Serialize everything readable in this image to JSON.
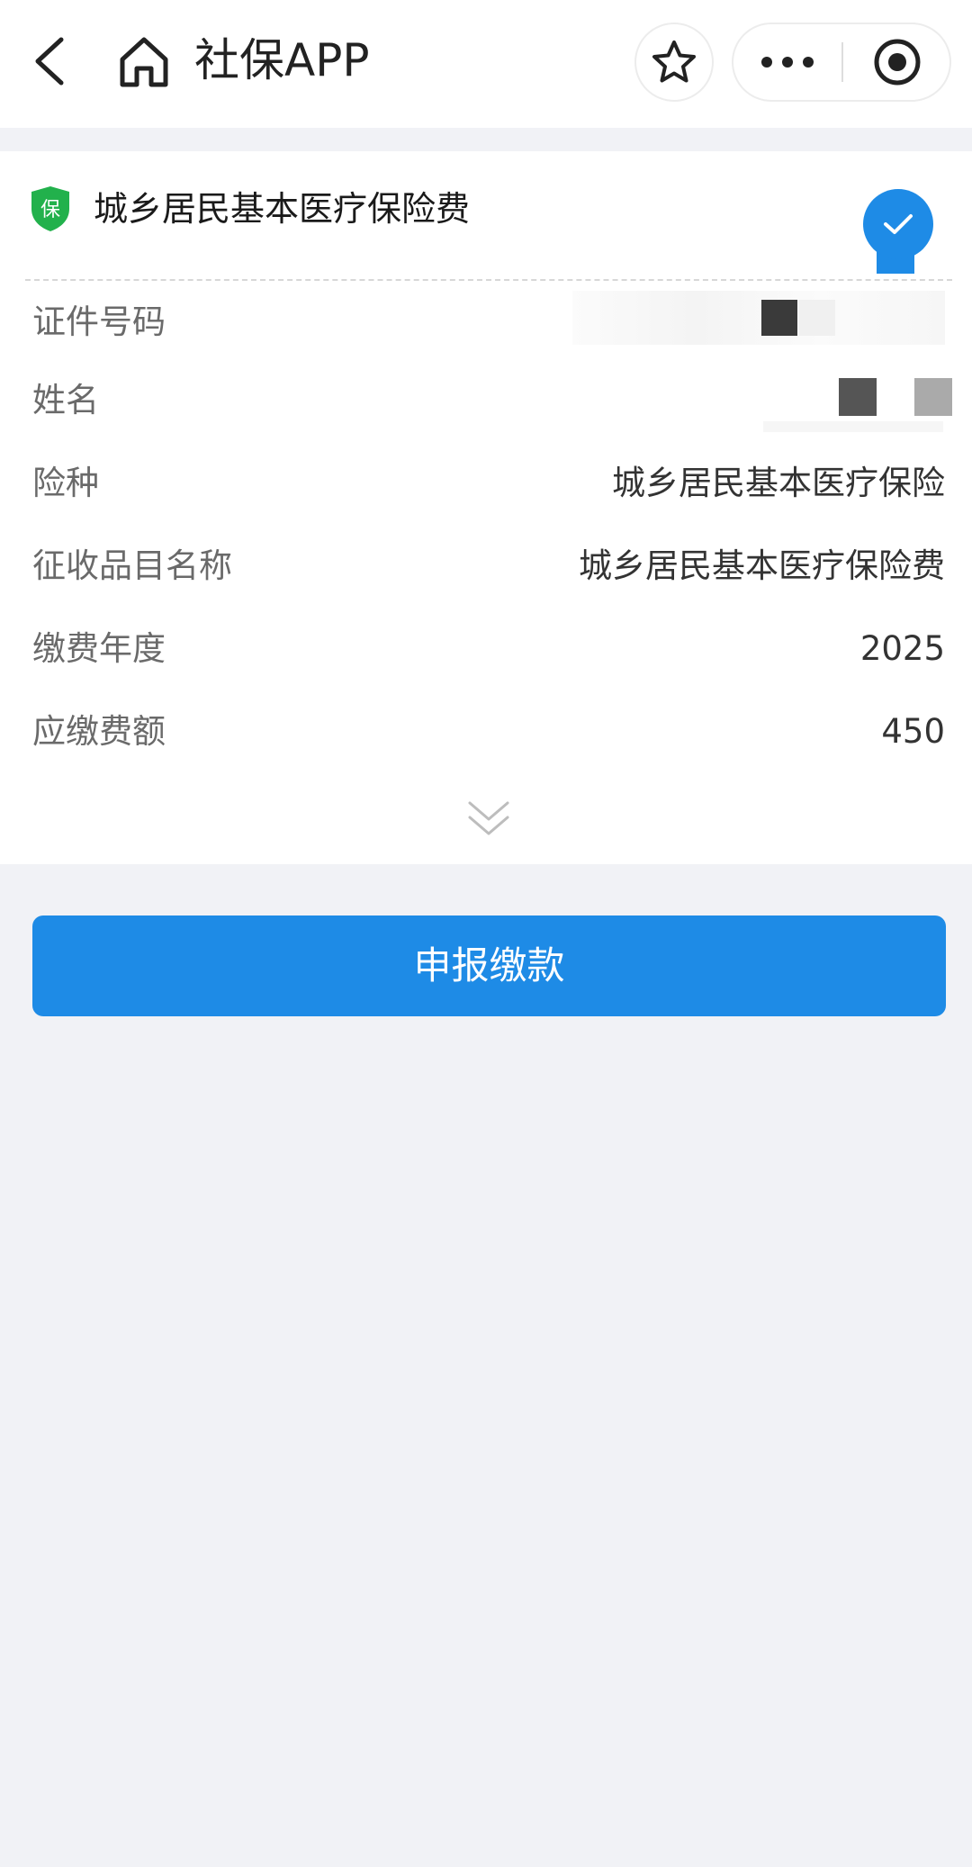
{
  "nav": {
    "title": "社保APP"
  },
  "card": {
    "title": "城乡居民基本医疗保险费",
    "badge_text": "保",
    "selected": true,
    "rows": [
      {
        "label": "证件号码",
        "value": ""
      },
      {
        "label": "姓名",
        "value": ""
      },
      {
        "label": "险种",
        "value": "城乡居民基本医疗保险"
      },
      {
        "label": "征收品目名称",
        "value": "城乡居民基本医疗保险费"
      },
      {
        "label": "缴费年度",
        "value": "2025"
      },
      {
        "label": "应缴费额",
        "value": "450"
      }
    ]
  },
  "actions": {
    "submit_label": "申报缴款"
  },
  "colors": {
    "accent": "#1e8be6",
    "badge_green": "#22b14c",
    "page_bg": "#f1f2f6"
  },
  "icons": {
    "back": "chevron-left-icon",
    "home": "home-icon",
    "favorite": "star-icon",
    "more": "more-dots-icon",
    "close_mini": "target-circle-icon",
    "badge": "shield-badge-icon",
    "check": "check-circle-icon",
    "expand": "double-chevron-down-icon"
  }
}
